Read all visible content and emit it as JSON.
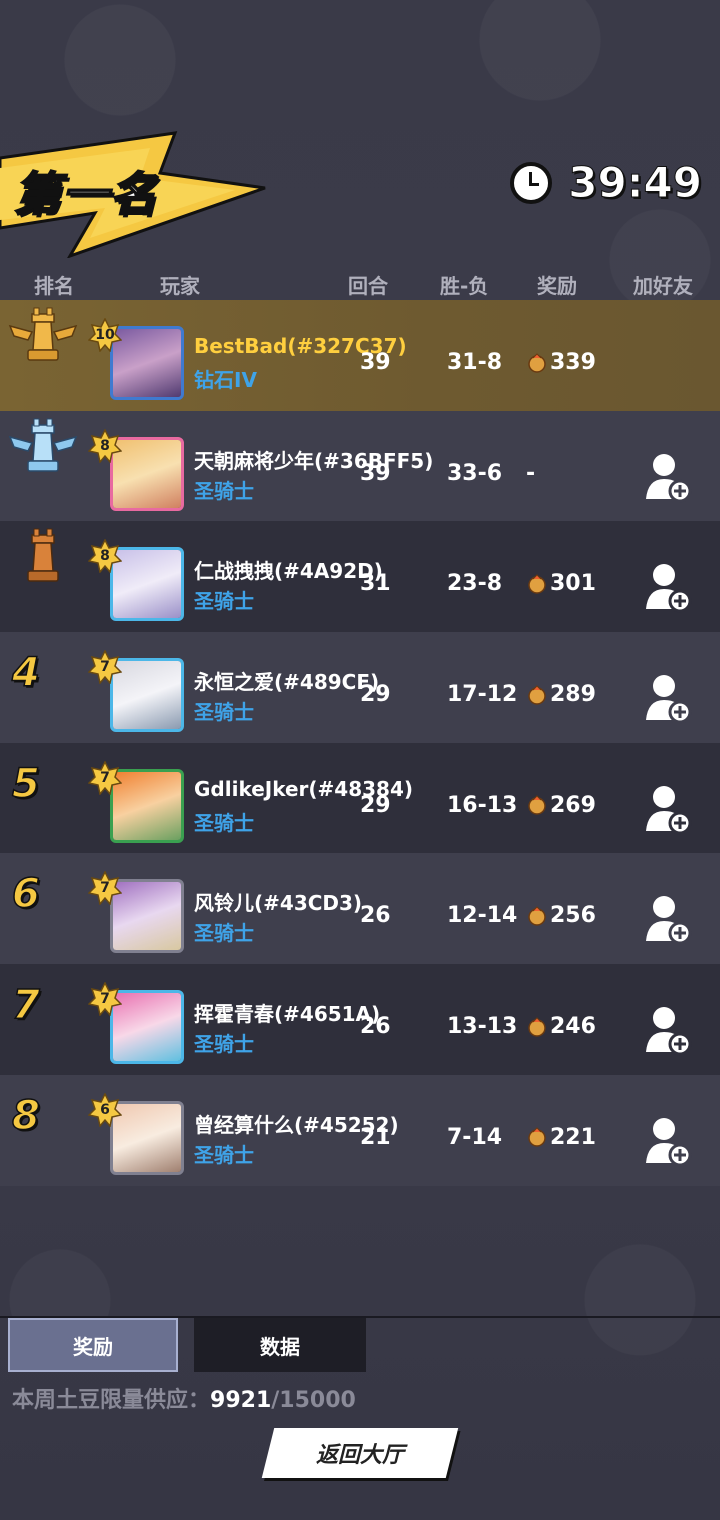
{
  "header": {
    "title": "第一名",
    "timer": "39:49"
  },
  "columns": {
    "rank": "排名",
    "player": "玩家",
    "rounds": "回合",
    "win_loss": "胜-负",
    "reward": "奖励",
    "add_friend": "加好友"
  },
  "rows": [
    {
      "rank": "1",
      "level": "10",
      "name": "BestBad(#327C37)",
      "title": "钻石IV",
      "rounds": "39",
      "wl": "31-8",
      "reward": "339",
      "trophy": "gold-rook-trophy",
      "add_friend": false
    },
    {
      "rank": "2",
      "level": "8",
      "name": "天朝麻将少年(#36BFF5)",
      "title": "圣骑士",
      "rounds": "39",
      "wl": "33-6",
      "reward": "-",
      "trophy": "silver-rook-trophy",
      "add_friend": true
    },
    {
      "rank": "3",
      "level": "8",
      "name": "仁战拽拽(#4A92D)",
      "title": "圣骑士",
      "rounds": "31",
      "wl": "23-8",
      "reward": "301",
      "trophy": "bronze-rook-trophy",
      "add_friend": true
    },
    {
      "rank": "4",
      "level": "7",
      "name": "永恒之爱(#489CF)",
      "title": "圣骑士",
      "rounds": "29",
      "wl": "17-12",
      "reward": "289",
      "add_friend": true
    },
    {
      "rank": "5",
      "level": "7",
      "name": "GdlikeJker(#48384)",
      "title": "圣骑士",
      "rounds": "29",
      "wl": "16-13",
      "reward": "269",
      "add_friend": true
    },
    {
      "rank": "6",
      "level": "7",
      "name": "风铃儿(#43CD3)",
      "title": "圣骑士",
      "rounds": "26",
      "wl": "12-14",
      "reward": "256",
      "add_friend": true
    },
    {
      "rank": "7",
      "level": "7",
      "name": "挥霍青春(#4651A)",
      "title": "圣骑士",
      "rounds": "26",
      "wl": "13-13",
      "reward": "246",
      "add_friend": true
    },
    {
      "rank": "8",
      "level": "6",
      "name": "曾经算什么(#45252)",
      "title": "圣骑士",
      "rounds": "21",
      "wl": "7-14",
      "reward": "221",
      "add_friend": true
    }
  ],
  "tabs": {
    "reward": "奖励",
    "data": "数据"
  },
  "supply": {
    "label": "本周土豆限量供应：",
    "value": "9921",
    "max": "/15000"
  },
  "back_button": "返回大厅",
  "colors": {
    "accent_gold": "#f5c842",
    "title_blue": "#3fa3e8",
    "first_row_bg": "#7a6433"
  }
}
